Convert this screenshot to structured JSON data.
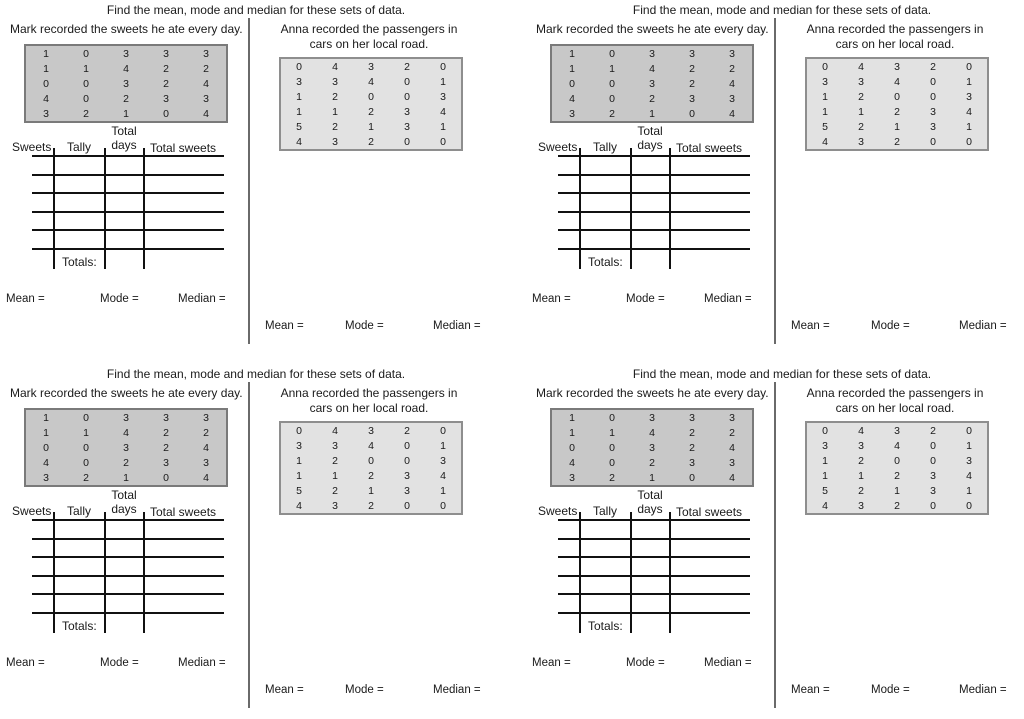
{
  "sheet": {
    "instruction": "Find the mean, mode and median for these sets of data.",
    "mark": {
      "title": "Mark recorded the sweets he ate every day.",
      "rows": [
        [
          1,
          0,
          3,
          3,
          3
        ],
        [
          1,
          1,
          4,
          2,
          2
        ],
        [
          0,
          0,
          3,
          2,
          4
        ],
        [
          4,
          0,
          2,
          3,
          3
        ],
        [
          3,
          2,
          1,
          0,
          4
        ]
      ],
      "table_headers": {
        "sweets": "Sweets",
        "tally": "Tally",
        "total_days_line1": "Total",
        "total_days_line2": "days",
        "total_sweets": "Total sweets"
      },
      "totals_label": "Totals:",
      "blank_rows": 6
    },
    "anna": {
      "title": "Anna recorded the passengers in cars on her local road.",
      "rows": [
        [
          0,
          4,
          3,
          2,
          0
        ],
        [
          3,
          3,
          4,
          0,
          1
        ],
        [
          1,
          2,
          0,
          0,
          3
        ],
        [
          1,
          1,
          2,
          3,
          4
        ],
        [
          5,
          2,
          1,
          3,
          1
        ],
        [
          4,
          3,
          2,
          0,
          0
        ]
      ]
    },
    "answers": {
      "mean": "Mean =",
      "mode": "Mode =",
      "median": "Median ="
    },
    "colors": {
      "mark_table_bg": "#c8c8c8",
      "anna_table_bg": "#e2e2e2",
      "divider": "#6a6a6a"
    },
    "copies": 4
  }
}
